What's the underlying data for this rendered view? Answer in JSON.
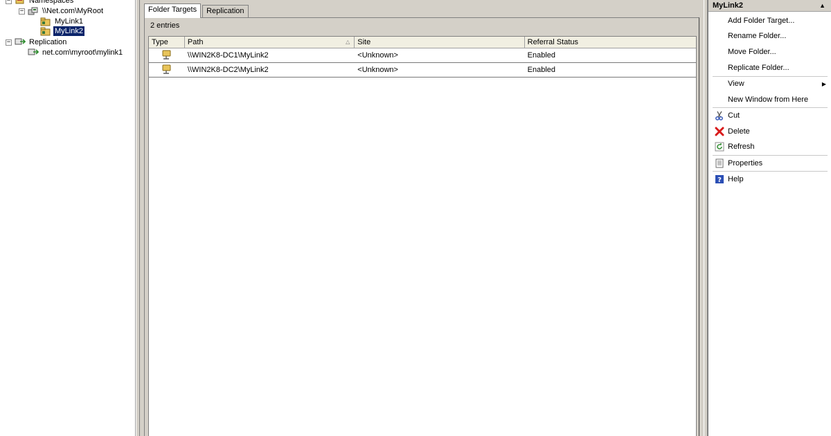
{
  "tree": {
    "namespaces_label": "Namespaces",
    "root_label": "\\\\Net.com\\MyRoot",
    "link1_label": "MyLink1",
    "link2_label": "MyLink2",
    "replication_label": "Replication",
    "replication_child_label": "net.com\\myroot\\mylink1",
    "collapse_glyph": "−"
  },
  "center": {
    "tabs": [
      {
        "label": "Folder Targets"
      },
      {
        "label": "Replication"
      }
    ],
    "entries_text": "2 entries",
    "columns": [
      "Type",
      "Path",
      "Site",
      "Referral Status"
    ],
    "rows": [
      {
        "path": "\\\\WIN2K8-DC1\\MyLink2",
        "site": "<Unknown>",
        "status": "Enabled"
      },
      {
        "path": "\\\\WIN2K8-DC2\\MyLink2",
        "site": "<Unknown>",
        "status": "Enabled"
      }
    ]
  },
  "actions": {
    "header": "MyLink2",
    "collapse_glyph": "▲",
    "items": [
      {
        "label": "Add Folder Target..."
      },
      {
        "label": "Rename Folder..."
      },
      {
        "label": "Move Folder..."
      },
      {
        "label": "Replicate Folder..."
      },
      {
        "label": "View"
      },
      {
        "label": "New Window from Here"
      },
      {
        "label": "Cut"
      },
      {
        "label": "Delete"
      },
      {
        "label": "Refresh"
      },
      {
        "label": "Properties"
      },
      {
        "label": "Help"
      }
    ]
  },
  "colors": {
    "selection": "#0a246a",
    "panel_gray": "#d4d0c8",
    "delete_red": "#d8191a",
    "refresh_green": "#2e8b2e",
    "help_blue": "#2b4fb5"
  }
}
